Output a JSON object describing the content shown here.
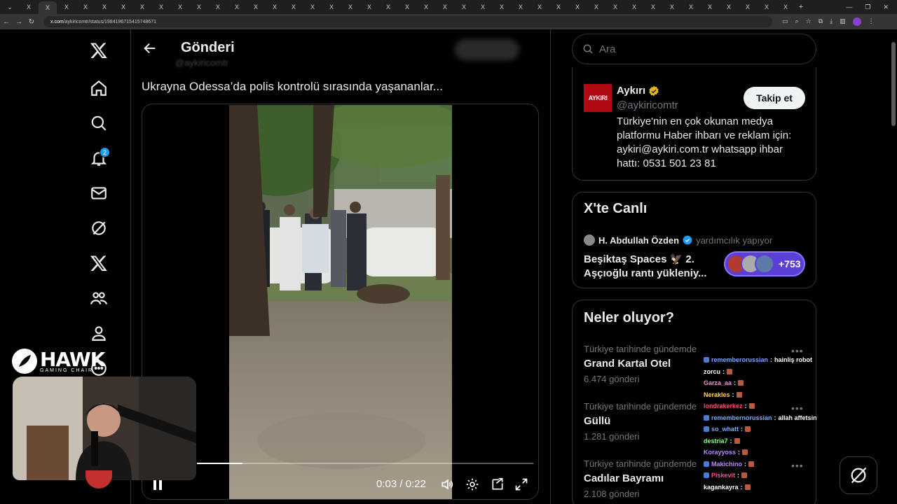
{
  "browser": {
    "tab_label": "X",
    "url_host": "x.com",
    "url_path": "/aykiricomtr/status/1984196715415748671"
  },
  "nav": {
    "notifications_badge": "2"
  },
  "header": {
    "title": "Gönderi",
    "hidden_handle": "@aykiricomtr"
  },
  "post": {
    "text": "Ukrayna Odessa’da polis kontrolü sırasında yaşananlar..."
  },
  "video": {
    "time": "0:03 / 0:22",
    "progress": 0.136
  },
  "overlay": {
    "brand": "HAWK",
    "brand_sub": "GAMING CHAIR"
  },
  "search": {
    "placeholder": "Ara"
  },
  "profile": {
    "avatar_text": "AYKIRI",
    "name": "Aykırı",
    "handle": "@aykiricomtr",
    "follow_label": "Takip et",
    "bio": "Türkiye'nin en çok okunan medya platformu Haber ihbarı ve reklam için: aykiri@aykiri.com.tr whatsapp ihbar hattı: 0531 501 23 81"
  },
  "live": {
    "title": "X'te Canlı",
    "host_name": "H. Abdullah Özden",
    "host_status": "yardımcılık yapıyor",
    "space_title": "Beşiktaş Spaces 🦅 2. Aşçıoğlu rantı yükleniy...",
    "listener_count": "+753"
  },
  "trends": {
    "title": "Neler oluyor?",
    "items": [
      {
        "context": "Türkiye tarihinde gündemde",
        "name": "Grand Kartal Otel",
        "count": "6.474 gönderi"
      },
      {
        "context": "Türkiye tarihinde gündemde",
        "name": "Güllü",
        "count": "1.281 gönderi"
      },
      {
        "context": "Türkiye tarihinde gündemde",
        "name": "Cadılar Bayramı",
        "count": "2.108 gönderi"
      }
    ]
  },
  "chat": [
    {
      "user": "rememberorussian",
      "color": "#7aa7ff",
      "msg": "hainliş robot",
      "badge": true
    },
    {
      "user": "zorcu",
      "color": "#ffffff",
      "msg": "",
      "emote": true
    },
    {
      "user": "Garza_aa",
      "color": "#ff8ad8",
      "msg": "",
      "emote": true
    },
    {
      "user": "Nerakles",
      "color": "#ffd35c",
      "msg": "",
      "emote": true
    },
    {
      "user": "londrakerkez",
      "color": "#ff4d6d",
      "msg": "",
      "emote": true
    },
    {
      "user": "remembernorussian",
      "color": "#7aa7ff",
      "msg": "allah affetsin",
      "badge": true
    },
    {
      "user": "so_whatt",
      "color": "#7aa7ff",
      "msg": "",
      "emote": true,
      "badge": true
    },
    {
      "user": "destria7",
      "color": "#8aff8a",
      "msg": "",
      "emote": true
    },
    {
      "user": "Korayyoss",
      "color": "#b98cff",
      "msg": "",
      "emote": true
    },
    {
      "user": "Makichino",
      "color": "#b98cff",
      "msg": "",
      "emote": true,
      "badge": true
    },
    {
      "user": "Piskevit",
      "color": "#ff4d9a",
      "msg": "",
      "emote": true,
      "badge": true
    },
    {
      "user": "kagankayra",
      "color": "#ffffff",
      "msg": "",
      "emote": true
    }
  ],
  "colors": {
    "accent": "#1d9bf0",
    "live_pill": "#5b3fd6",
    "border": "#2f3336",
    "muted": "#71767b"
  }
}
